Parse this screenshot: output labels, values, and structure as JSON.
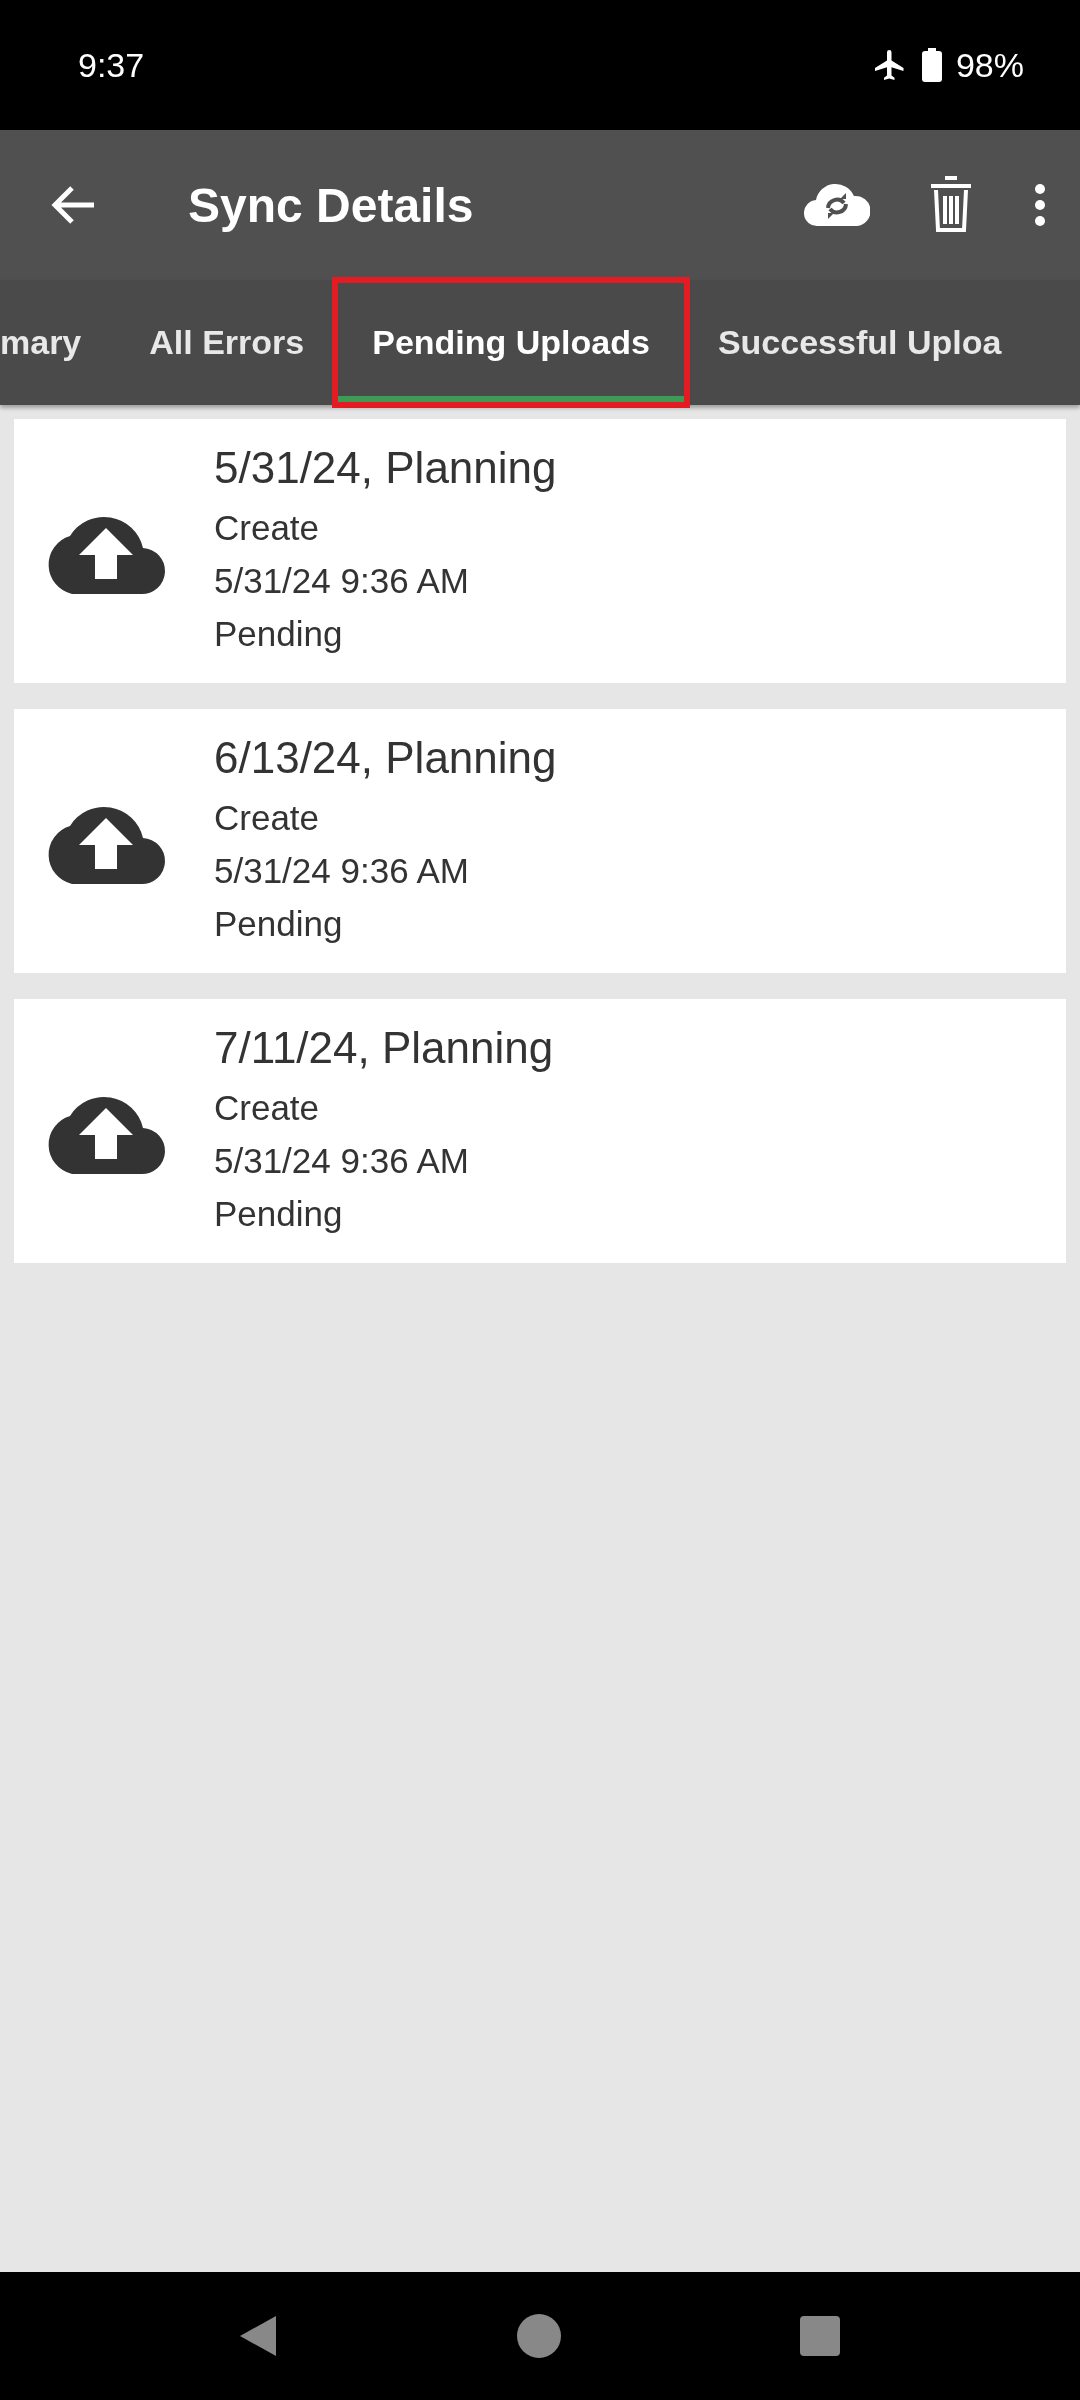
{
  "status_bar": {
    "time": "9:37",
    "battery": "98%"
  },
  "app_bar": {
    "title": "Sync Details"
  },
  "tabs": [
    {
      "label": "mary",
      "selected": false,
      "highlighted": false
    },
    {
      "label": "All Errors",
      "selected": false,
      "highlighted": false
    },
    {
      "label": "Pending Uploads",
      "selected": true,
      "highlighted": true
    },
    {
      "label": "Successful Uploa",
      "selected": false,
      "highlighted": false
    }
  ],
  "items": [
    {
      "title": "5/31/24, Planning",
      "action": "Create",
      "timestamp": "5/31/24 9:36 AM",
      "status": "Pending"
    },
    {
      "title": "6/13/24, Planning",
      "action": "Create",
      "timestamp": "5/31/24 9:36 AM",
      "status": "Pending"
    },
    {
      "title": "7/11/24, Planning",
      "action": "Create",
      "timestamp": "5/31/24 9:36 AM",
      "status": "Pending"
    }
  ]
}
